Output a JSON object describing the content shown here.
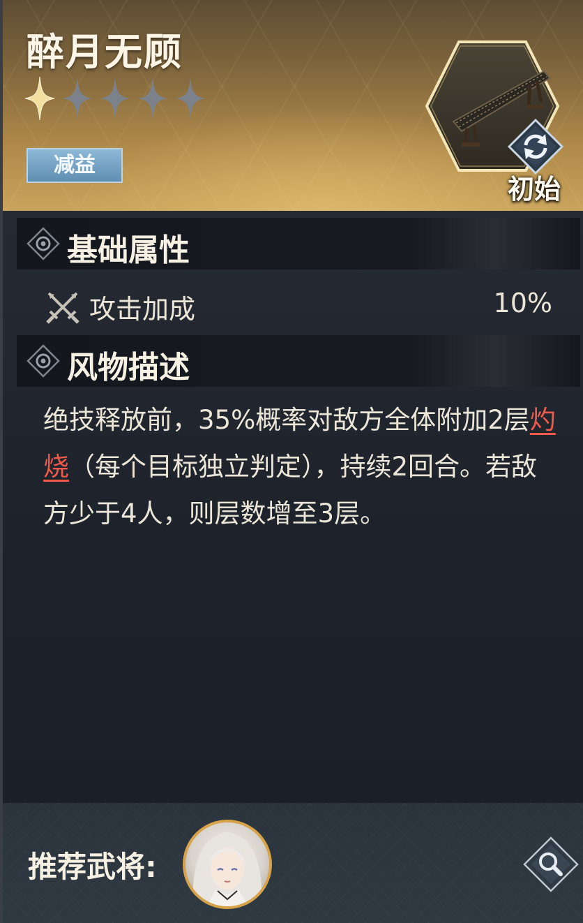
{
  "item": {
    "name": "醉月无顾",
    "stars_filled": 1,
    "stars_total": 5,
    "tag": "减益",
    "state_label": "初始"
  },
  "sections": {
    "basic_title": "基础属性",
    "desc_title": "风物描述"
  },
  "attribute": {
    "label": "攻击加成",
    "value": "10%"
  },
  "description": {
    "part1": "绝技释放前，35%概率对敌方全体附加2层",
    "keyword": "灼烧",
    "part2": "（每个目标独立判定），持续2回合。若敌方少于4人，则层数增至3层。"
  },
  "footer": {
    "recommend_label": "推荐武将:"
  },
  "icons": {
    "stars": "sparkle-star-icon",
    "refresh": "refresh-icon",
    "section": "diamond-eye-icon",
    "attack": "crossed-swords-icon",
    "search": "magnifier-icon"
  },
  "colors": {
    "star_filled": "#f3dfa0",
    "star_empty": "#7b828c",
    "keyword": "#ef5a4a",
    "avatar_border": "#d7a34a",
    "tag_blue": "#6f9dbf"
  }
}
